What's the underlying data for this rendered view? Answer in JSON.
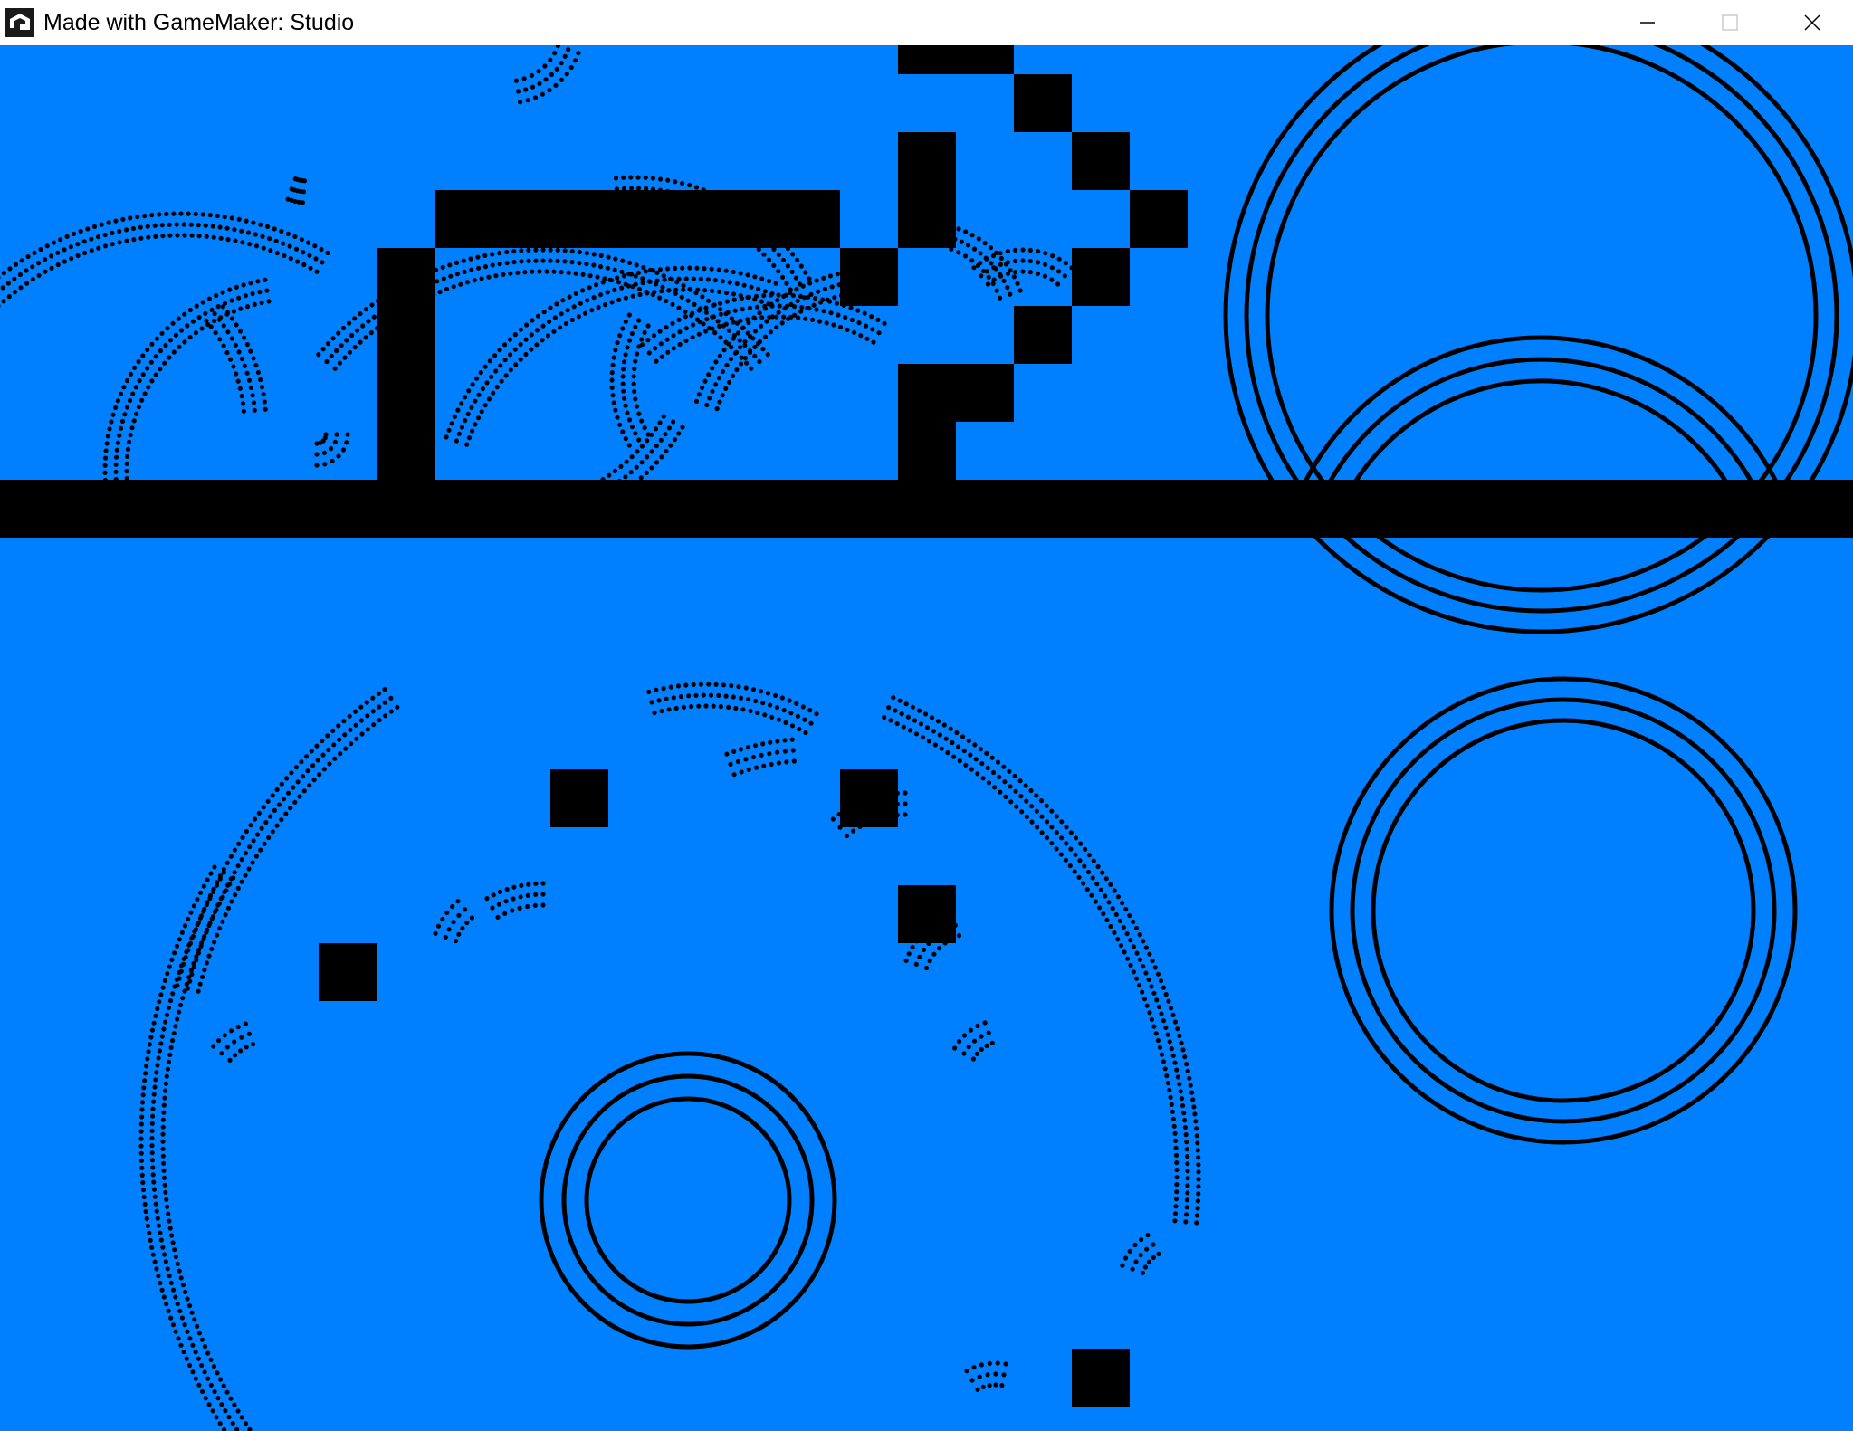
{
  "window": {
    "title": "Made with GameMaker: Studio",
    "controls": [
      "minimize",
      "maximize",
      "close"
    ]
  },
  "game": {
    "background_color": "#0080ff",
    "foreground_color": "#000000"
  },
  "icons": {
    "app": "gamemaker-icon",
    "minimize": "minimize-icon",
    "maximize": "maximize-icon",
    "close": "close-icon"
  }
}
